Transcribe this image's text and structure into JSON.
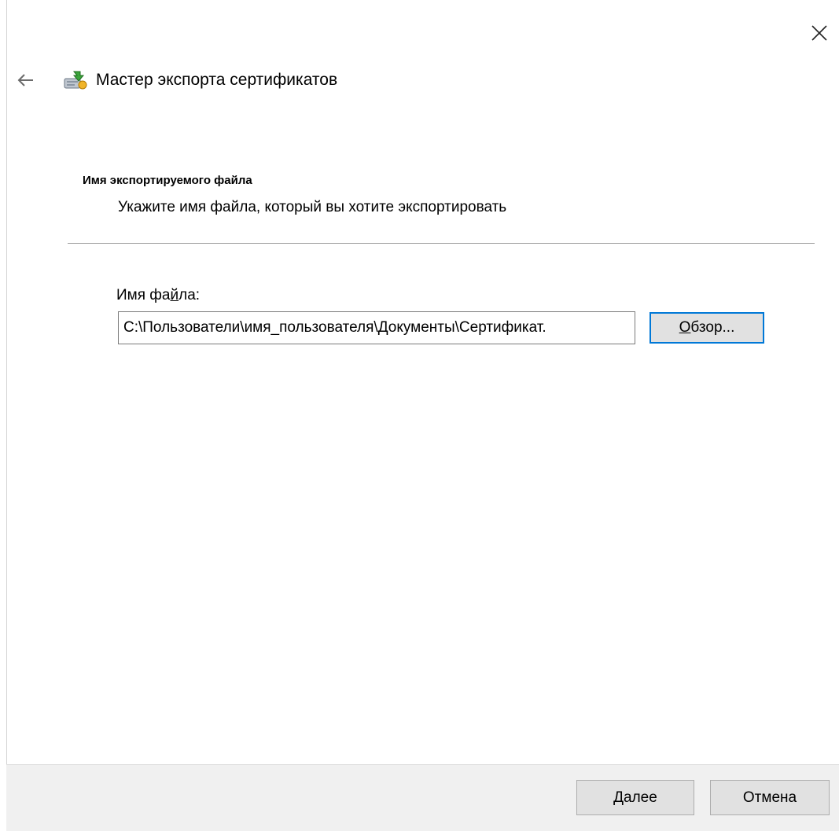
{
  "window": {
    "close_icon": "close-icon",
    "back_icon": "back-arrow-icon"
  },
  "wizard": {
    "title": "Мастер экспорта сертификатов",
    "icon": "certificate-wizard-icon"
  },
  "section": {
    "heading": "Имя экспортируемого файла",
    "description": "Укажите имя файла, который вы хотите экспортировать"
  },
  "filename": {
    "label_before": "Имя фа",
    "label_accel": "й",
    "label_after": "ла:",
    "value": "C:\\Пользователи\\имя_пользователя\\Документы\\Сертификат.",
    "browse_accel": "О",
    "browse_rest": "бзор..."
  },
  "footer": {
    "next_accel": "Д",
    "next_rest": "алее",
    "cancel_label": "Отмена"
  },
  "colors": {
    "focus_border": "#0078d7",
    "button_face": "#e1e1e1",
    "footer_bg": "#f0f0f0"
  }
}
